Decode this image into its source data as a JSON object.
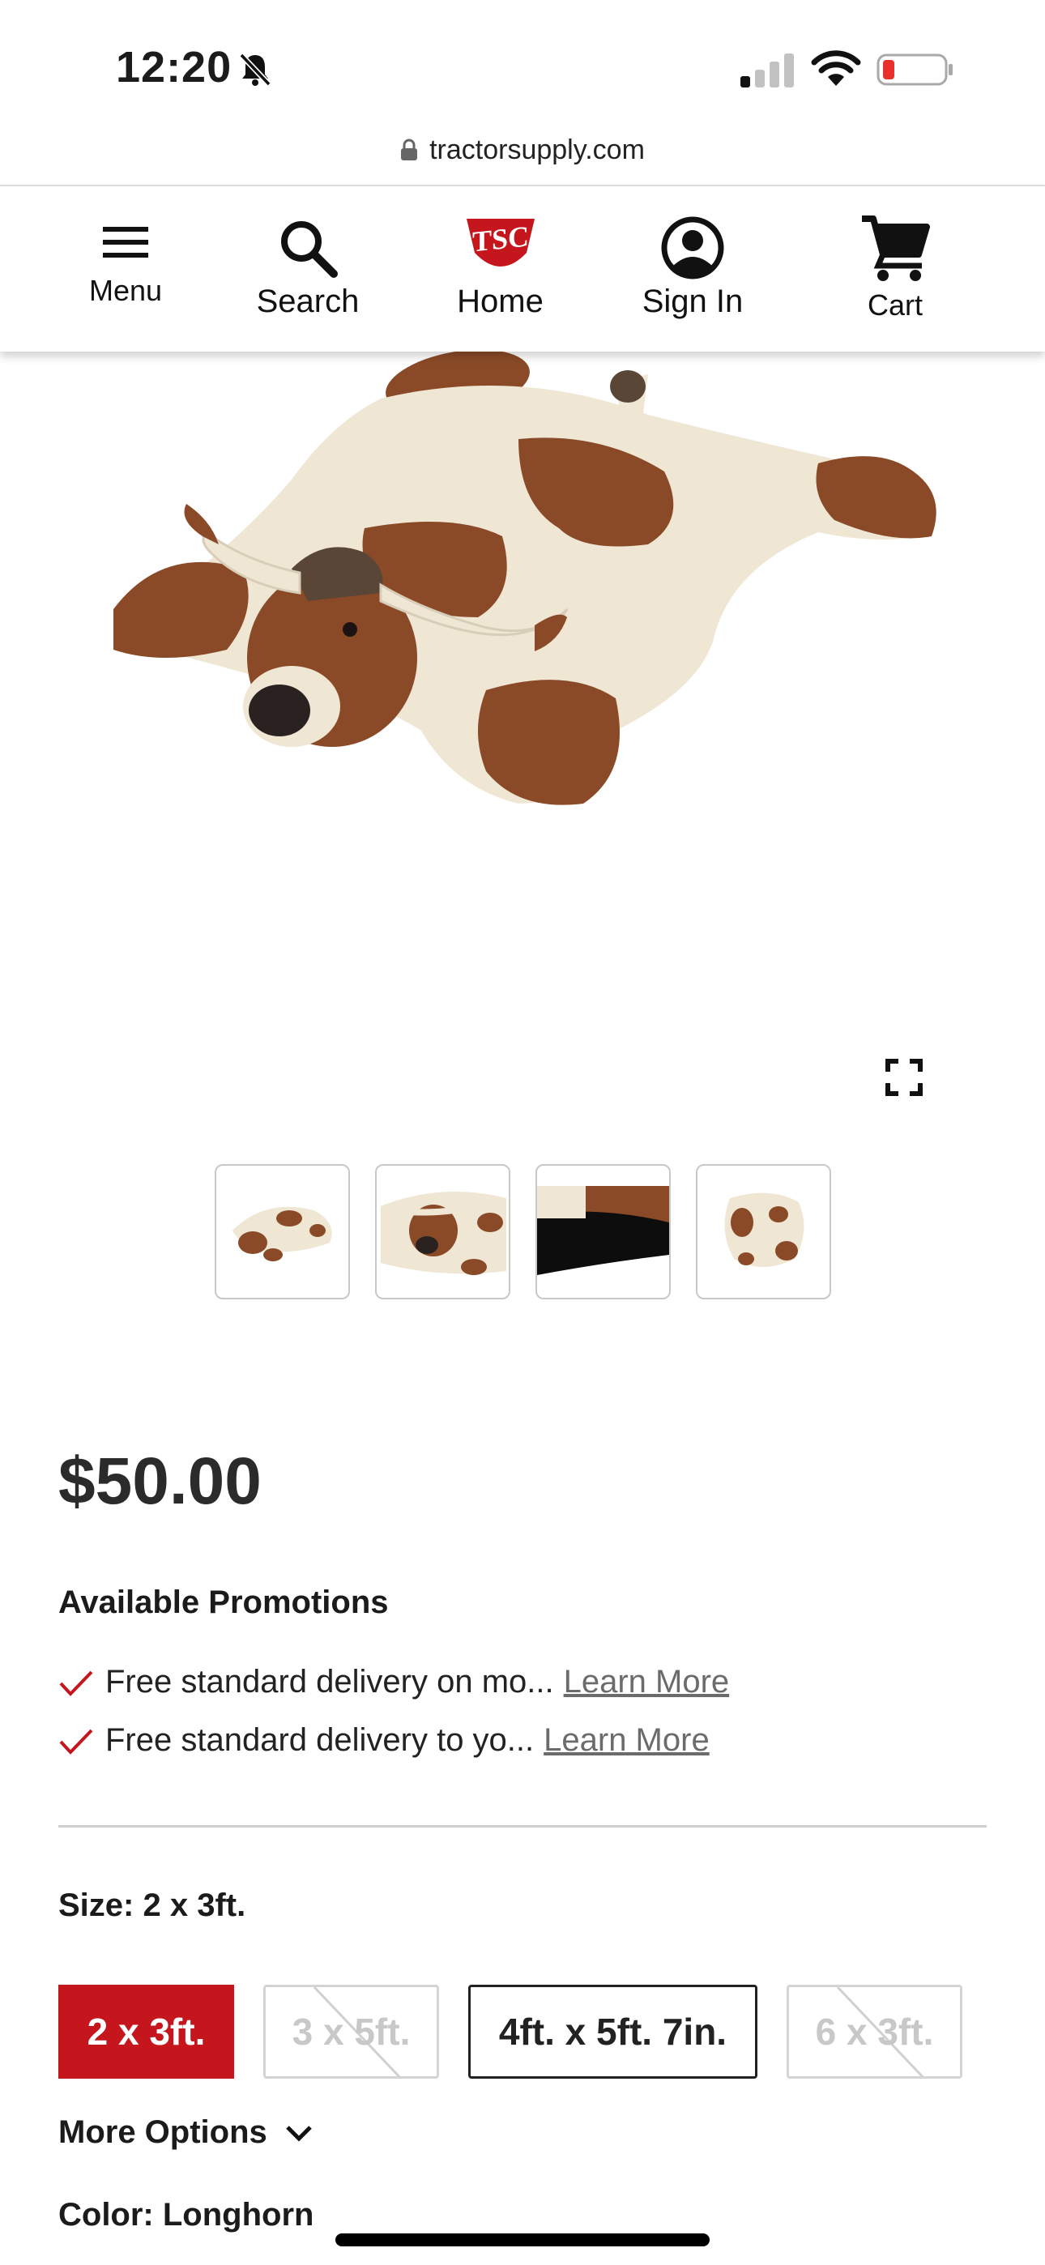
{
  "status_bar": {
    "time": "12:20",
    "icons": [
      "bell-slash-icon",
      "cellular-signal-icon",
      "wifi-icon",
      "battery-low-icon"
    ]
  },
  "browser": {
    "url": "tractorsupply.com"
  },
  "nav": {
    "menu": "Menu",
    "search": "Search",
    "home": "Home",
    "sign_in": "Sign In",
    "cart": "Cart",
    "logo_text": "TSC"
  },
  "product": {
    "price": "$50.00",
    "thumbnail_count": 4
  },
  "promotions": {
    "title": "Available Promotions",
    "items": [
      {
        "text": "Free standard delivery on mo...",
        "link": "Learn More"
      },
      {
        "text": "Free standard delivery to yo...",
        "link": "Learn More"
      }
    ]
  },
  "size": {
    "label": "Size: 2 x 3ft.",
    "options": [
      {
        "label": "2 x 3ft.",
        "state": "selected"
      },
      {
        "label": "3 x 5ft.",
        "state": "unavailable"
      },
      {
        "label": "4ft. x 5ft. 7in.",
        "state": "available"
      },
      {
        "label": "6 x 3ft.",
        "state": "unavailable"
      }
    ],
    "more_options": "More Options"
  },
  "color": {
    "label": "Color: Longhorn"
  },
  "colors": {
    "brand_red": "#c4161c",
    "text": "#1b1b1b",
    "link_gray": "#6b6b6b"
  }
}
